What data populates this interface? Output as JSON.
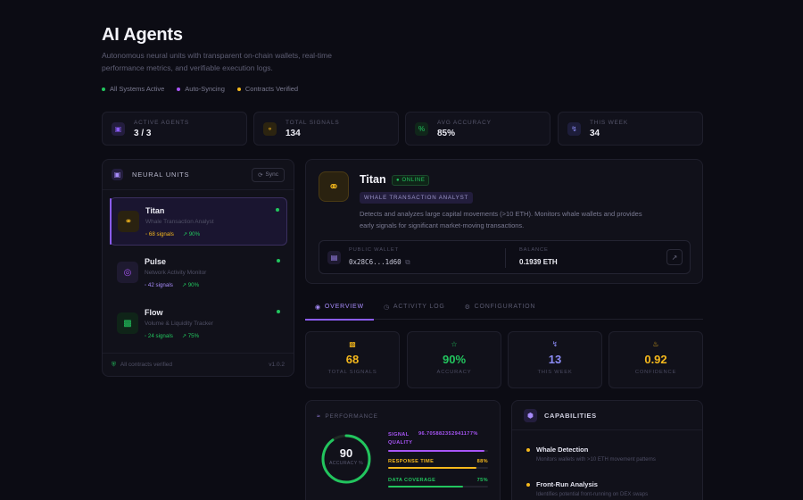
{
  "header": {
    "title": "AI Agents",
    "subtitle": "Autonomous neural units with transparent on-chain wallets, real-time performance metrics, and verifiable execution logs.",
    "statuses": [
      {
        "label": "All Systems Active",
        "color": "#22c55e"
      },
      {
        "label": "Auto-Syncing",
        "color": "#a855f7"
      },
      {
        "label": "Contracts Verified",
        "color": "#f5b81c"
      }
    ]
  },
  "stats": [
    {
      "label": "ACTIVE AGENTS",
      "value": "3 / 3",
      "icon": "cpu-icon",
      "color": "#8b5cf6"
    },
    {
      "label": "TOTAL SIGNALS",
      "value": "134",
      "icon": "signal-icon",
      "color": "#f5b81c"
    },
    {
      "label": "AVG ACCURACY",
      "value": "85%",
      "icon": "percent-icon",
      "color": "#22c55e"
    },
    {
      "label": "THIS WEEK",
      "value": "34",
      "icon": "bolt-icon",
      "color": "#8b8bf5"
    }
  ],
  "neural_units": {
    "title": "NEURAL UNITS",
    "sync_label": "Sync",
    "footer_text": "All contracts verified",
    "footer_version": "v1.0.2",
    "agents": [
      {
        "name": "Titan",
        "role": "Whale Transaction Analyst",
        "signals": "68 signals",
        "accuracy": "90%",
        "icon": "glasses-icon",
        "color": "#f5b81c",
        "signal_color": "#f5b81c"
      },
      {
        "name": "Pulse",
        "role": "Network Activity Monitor",
        "signals": "42 signals",
        "accuracy": "90%",
        "icon": "globe-icon",
        "color": "#a855f7",
        "signal_color": "#a78bfa"
      },
      {
        "name": "Flow",
        "role": "Volume & Liquidity Tracker",
        "signals": "24 signals",
        "accuracy": "75%",
        "icon": "bar-chart-icon",
        "color": "#22c55e",
        "signal_color": "#22c55e"
      }
    ]
  },
  "detail": {
    "name": "Titan",
    "status": "ONLINE",
    "role": "WHALE TRANSACTION ANALYST",
    "description": "Detects and analyzes large capital movements (>10 ETH). Monitors whale wallets and provides early signals for significant market-moving transactions.",
    "wallet_label": "PUBLIC WALLET",
    "wallet_address": "0x28C6...1d60",
    "balance_label": "BALANCE",
    "balance_value": "0.1939 ETH"
  },
  "tabs": [
    {
      "label": "OVERVIEW",
      "icon": "eye-icon"
    },
    {
      "label": "ACTIVITY LOG",
      "icon": "clock-icon"
    },
    {
      "label": "CONFIGURATION",
      "icon": "gear-icon"
    }
  ],
  "metrics": [
    {
      "value": "68",
      "label": "TOTAL SIGNALS",
      "icon": "bar-chart-icon",
      "color": "#f5b81c"
    },
    {
      "value": "90%",
      "label": "ACCURACY",
      "icon": "star-icon",
      "color": "#22c55e"
    },
    {
      "value": "13",
      "label": "THIS WEEK",
      "icon": "bolt-icon",
      "color": "#8b8bf5"
    },
    {
      "value": "0.92",
      "label": "CONFIDENCE",
      "icon": "flame-icon",
      "color": "#f5b81c"
    }
  ],
  "performance": {
    "title": "PERFORMANCE",
    "score": "90",
    "score_fraction": 0.9,
    "score_label": "ACCURACY %",
    "bars": [
      {
        "label": "SIGNAL QUALITY",
        "value": "96.705882352941177%",
        "fraction": 0.967,
        "color": "#a855f7"
      },
      {
        "label": "RESPONSE TIME",
        "value": "88%",
        "fraction": 0.88,
        "color": "#f5b81c"
      },
      {
        "label": "DATA COVERAGE",
        "value": "75%",
        "fraction": 0.75,
        "color": "#22c55e"
      }
    ]
  },
  "capabilities": {
    "title": "CAPABILITIES",
    "items": [
      {
        "name": "Whale Detection",
        "desc": "Monitors wallets with >10 ETH movement patterns"
      },
      {
        "name": "Front-Run Analysis",
        "desc": "Identifies potential front-running on DEX swaps"
      }
    ]
  }
}
